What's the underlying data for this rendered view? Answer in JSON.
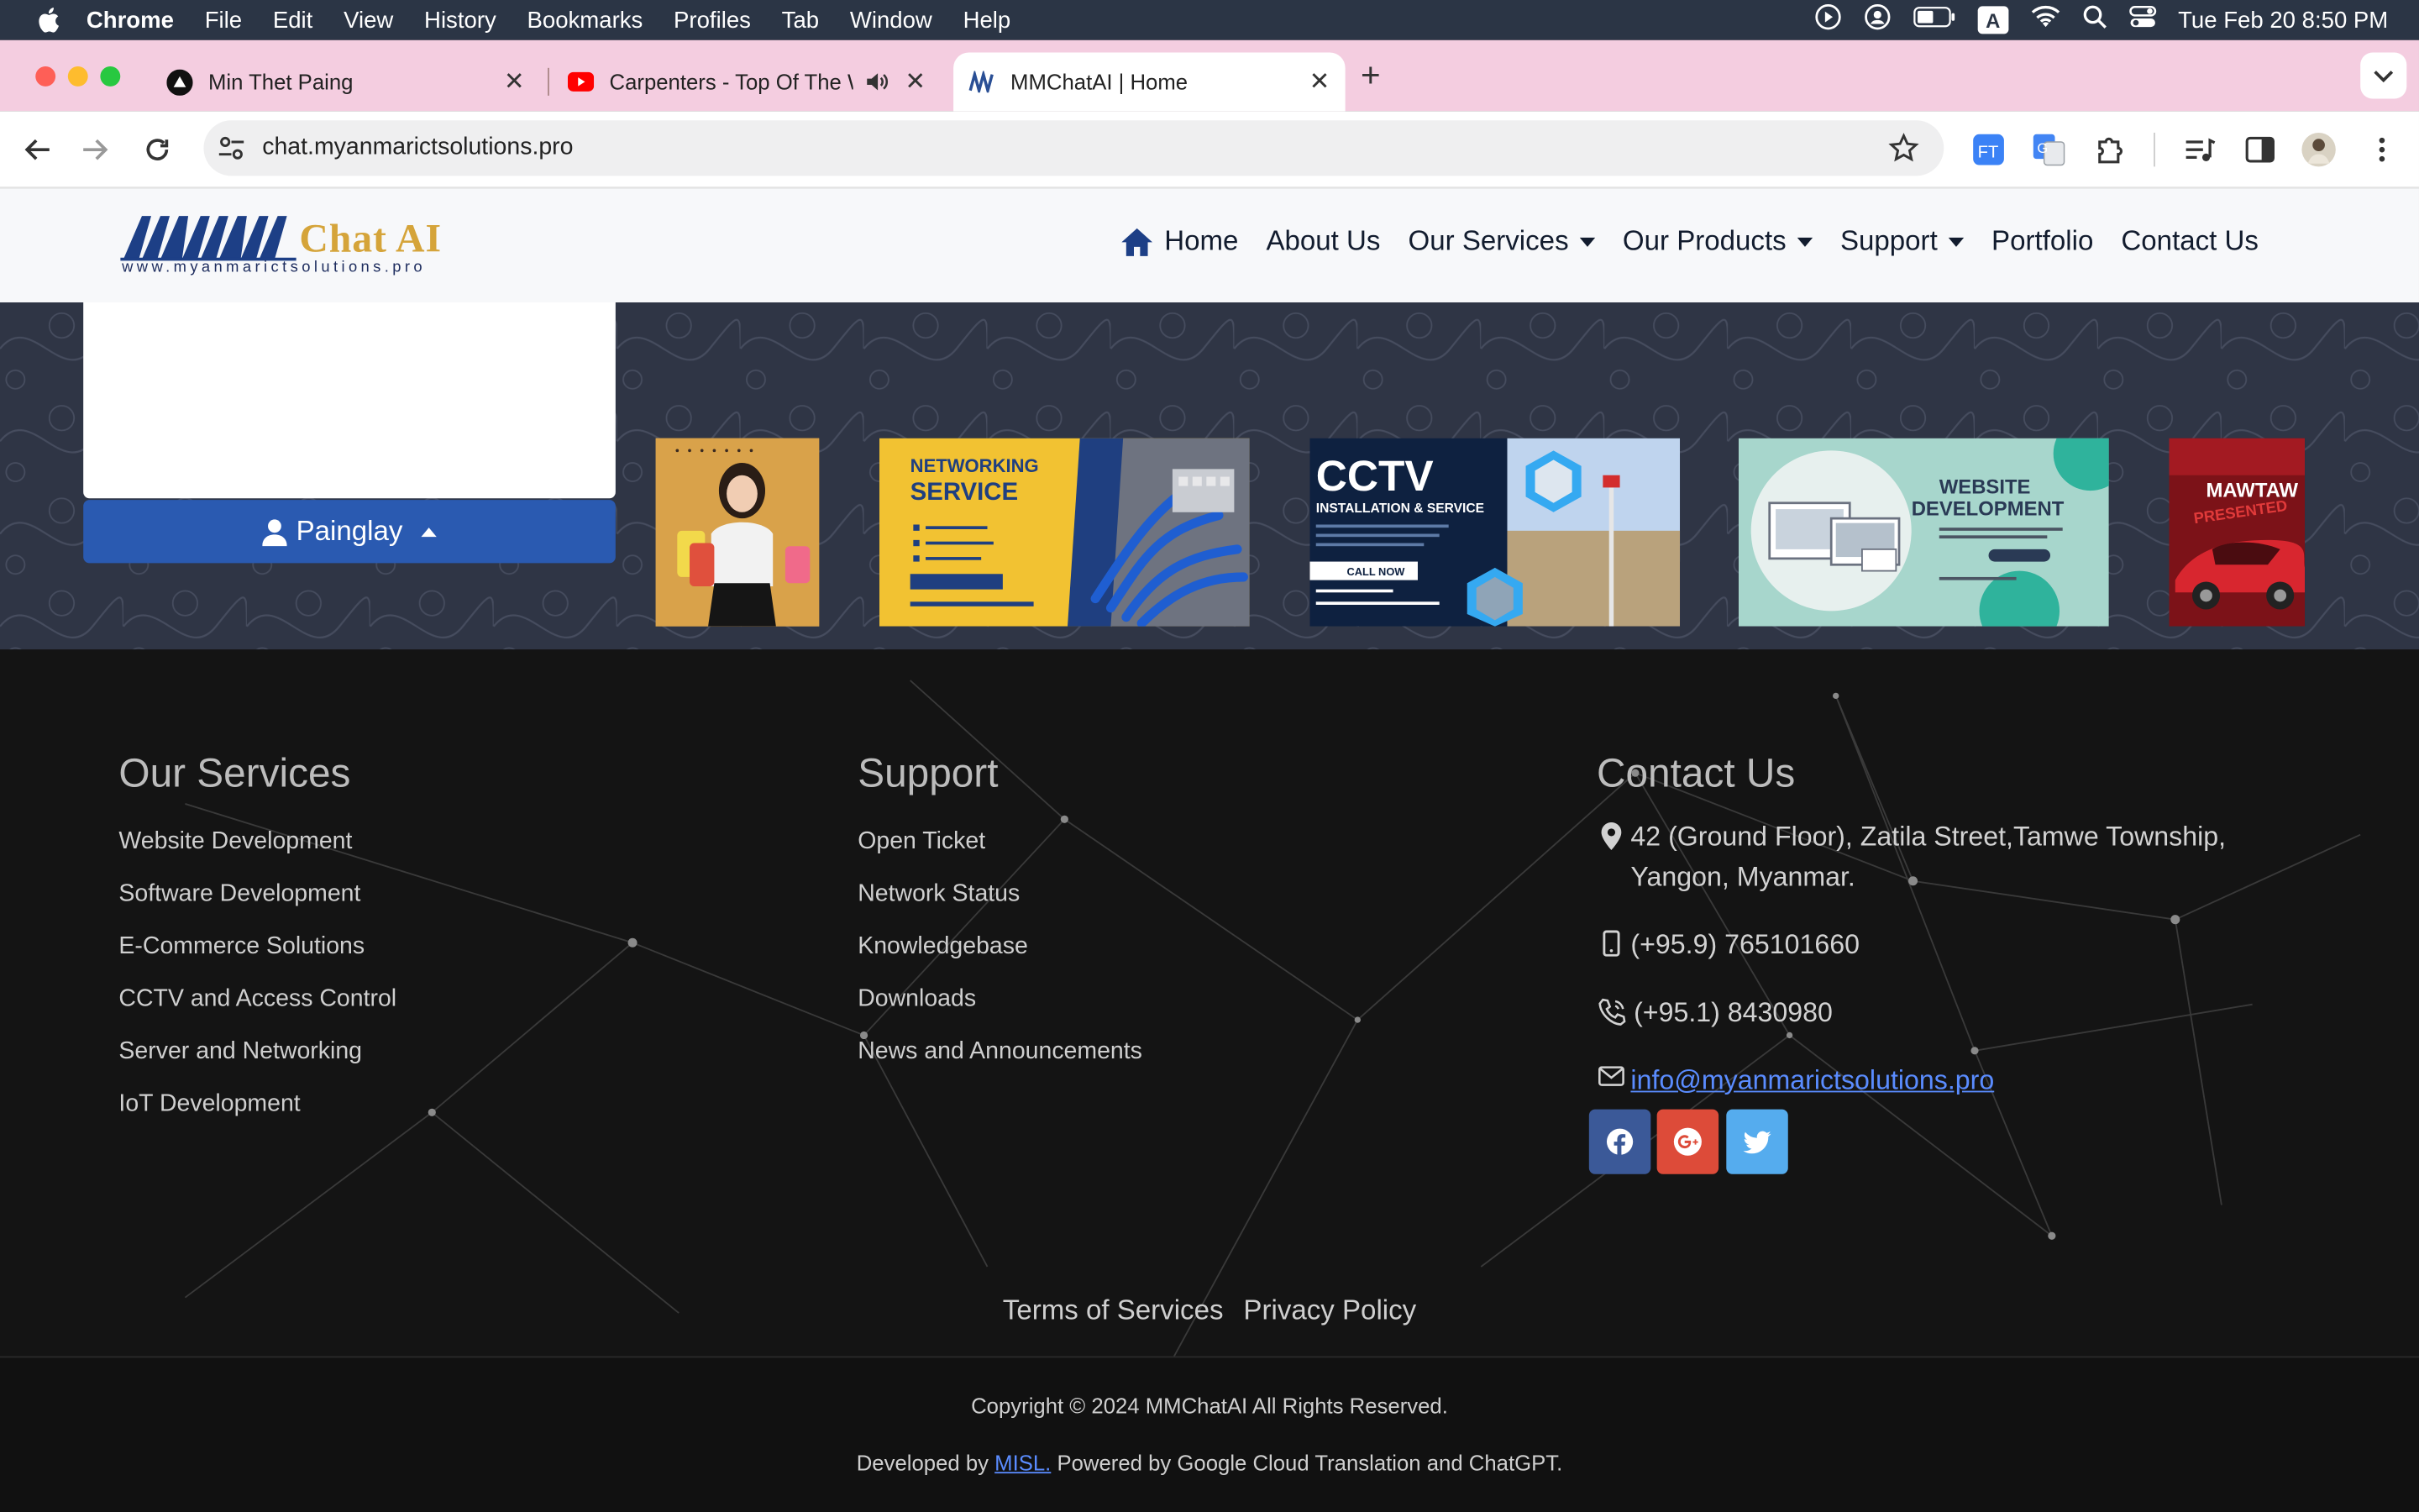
{
  "menubar": {
    "app": "Chrome",
    "items": [
      "File",
      "Edit",
      "View",
      "History",
      "Bookmarks",
      "Profiles",
      "Tab",
      "Window",
      "Help"
    ],
    "input_badge": "A",
    "clock": "Tue Feb 20  8:50 PM"
  },
  "tabs": [
    {
      "title": "Min Thet Paing",
      "icon": "vercel-triangle-icon"
    },
    {
      "title": "Carpenters - Top Of The World",
      "icon": "youtube-icon"
    },
    {
      "title": "MMChatAI | Home",
      "icon": "mm-favicon"
    }
  ],
  "address": {
    "url": "chat.myanmarictsolutions.pro"
  },
  "site": {
    "logo_chat": "Chat AI",
    "logo_url": "www.myanmarictsolutions.pro",
    "nav": {
      "home": "Home",
      "about": "About Us",
      "services": "Our Services",
      "products": "Our Products",
      "support": "Support",
      "portfolio": "Portfolio",
      "contact": "Contact Us"
    },
    "chat_user_button": "Painglay",
    "slides": {
      "networking_line1": "NETWORKING",
      "networking_line2": "SERVICE",
      "cctv_title": "CCTV",
      "cctv_sub": "INSTALLATION & SERVICE",
      "cctv_cta": "CALL NOW",
      "web_line1": "WEBSITE",
      "web_line2": "DEVELOPMENT",
      "mawtaw": "MAWTAW",
      "mawtaw_sub": "PRESENTED"
    }
  },
  "footer": {
    "services": {
      "title": "Our Services",
      "links": [
        "Website Development",
        "Software Development",
        "E-Commerce Solutions",
        "CCTV and Access Control",
        "Server and Networking",
        "IoT Development"
      ]
    },
    "support": {
      "title": "Support",
      "links": [
        "Open Ticket",
        "Network Status",
        "Knowledgebase",
        "Downloads",
        "News and Announcements"
      ]
    },
    "contact": {
      "title": "Contact Us",
      "address": "42 (Ground Floor), Zatila Street,Tamwe Township, Yangon, Myanmar.",
      "mobile": "(+95.9) 765101660",
      "phone": "(+95.1) 8430980",
      "email": "info@myanmarictsolutions.pro"
    },
    "terms": "Terms of Services",
    "privacy": "Privacy Policy",
    "copyright": "Copyright © 2024 MMChatAI All Rights Reserved.",
    "dev_prefix": "Developed by",
    "dev_link": "MISL.",
    "dev_suffix": "Powered by Google Cloud Translation and ChatGPT."
  },
  "colors": {
    "tabstrip": "#f4cde0",
    "primary_button": "#2a5ab1",
    "facebook": "#3b5998",
    "google": "#dd4b39",
    "twitter": "#55acee",
    "logo_gold": "#d5a43a",
    "logo_navy": "#1d2c5e"
  }
}
